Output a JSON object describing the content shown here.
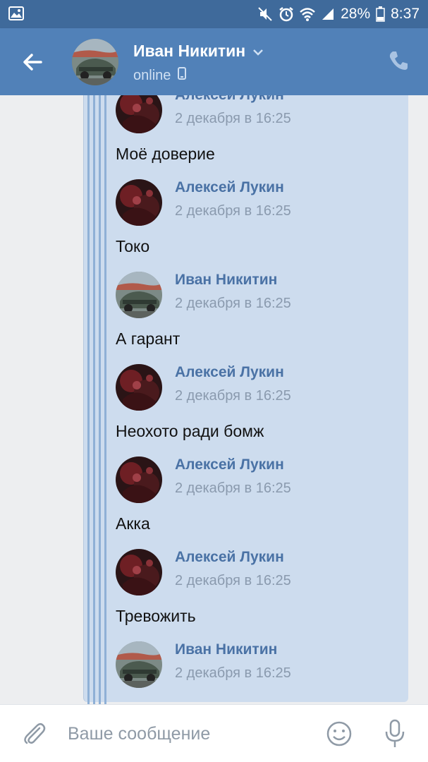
{
  "status_bar": {
    "battery": "28%",
    "time": "8:37",
    "icons": [
      "image-icon",
      "mute-icon",
      "alarm-icon",
      "wifi-icon",
      "signal-icon",
      "battery-icon"
    ]
  },
  "header": {
    "name": "Иван Никитин",
    "status": "online",
    "icons": [
      "back-arrow-icon",
      "chevron-down-icon",
      "mobile-icon",
      "phone-icon"
    ]
  },
  "forwarded": [
    {
      "author": "Алексей Лукин",
      "date": "2 декабря в 16:25",
      "text": "Моё доверие",
      "avatar": "dark"
    },
    {
      "author": "Алексей Лукин",
      "date": "2 декабря в 16:25",
      "text": "Токо",
      "avatar": "dark"
    },
    {
      "author": "Иван Никитин",
      "date": "2 декабря в 16:25",
      "text": "А гарант",
      "avatar": "car"
    },
    {
      "author": "Алексей Лукин",
      "date": "2 декабря в 16:25",
      "text": "Неохото ради бомж",
      "avatar": "dark"
    },
    {
      "author": "Алексей Лукин",
      "date": "2 декабря в 16:25",
      "text": "Акка",
      "avatar": "dark"
    },
    {
      "author": "Алексей Лукин",
      "date": "2 декабря в 16:25",
      "text": "Тревожить",
      "avatar": "dark"
    },
    {
      "author": "Иван Никитин",
      "date": "2 декабря в 16:25",
      "text": "",
      "avatar": "car"
    }
  ],
  "composer": {
    "placeholder": "Ваше сообщение",
    "icons": [
      "paperclip-icon",
      "emoji-icon",
      "mic-icon"
    ]
  },
  "colors": {
    "header": "#5181b8",
    "status_bar": "#3f6a9b",
    "bubble": "#cddcee",
    "author": "#4a72a5"
  }
}
